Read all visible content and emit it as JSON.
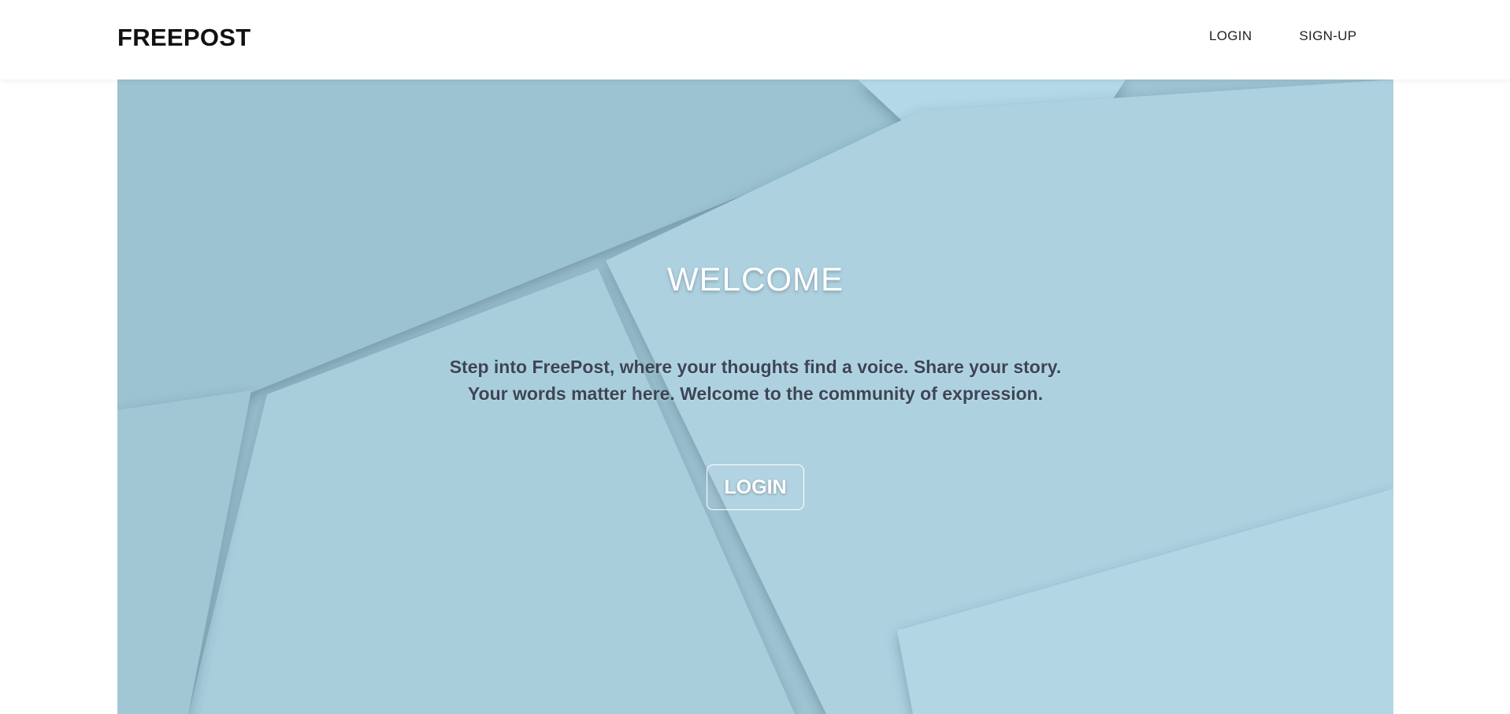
{
  "navbar": {
    "brand": "FREEPOST",
    "links": [
      {
        "label": "LOGIN"
      },
      {
        "label": "SIGN-UP"
      }
    ]
  },
  "hero": {
    "title": "WELCOME",
    "text": "Step into FreePost, where your thoughts find a voice. Share your story. Your words matter here. Welcome to the community of expression.",
    "button_label": "LOGIN"
  },
  "colors": {
    "hero_background": "#a9cfdd",
    "text_dark": "#3d4656",
    "nav_text": "#222222"
  }
}
